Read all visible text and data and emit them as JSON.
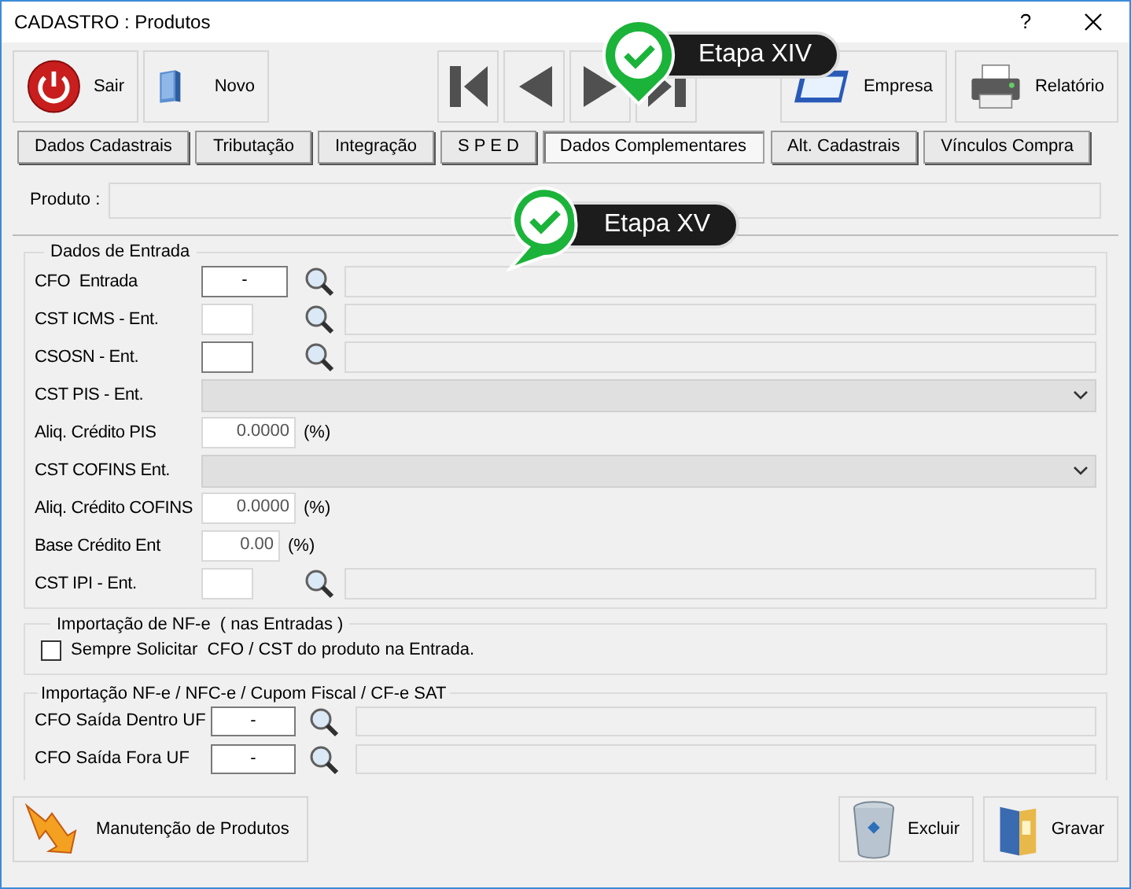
{
  "window": {
    "title": "CADASTRO : Produtos",
    "help": "?"
  },
  "toolbar": {
    "left": [
      {
        "label": "Sair"
      },
      {
        "label": "Novo"
      }
    ],
    "nav": [
      {
        "kind": "first"
      },
      {
        "kind": "prev"
      },
      {
        "kind": "next"
      },
      {
        "kind": "last"
      }
    ],
    "right": [
      {
        "label": "Empresa"
      },
      {
        "label": "Relatório"
      }
    ]
  },
  "tabs": [
    {
      "label": "Dados Cadastrais",
      "selected": false
    },
    {
      "label": "Tributação",
      "selected": false
    },
    {
      "label": "Integração",
      "selected": false
    },
    {
      "label": "S P E D",
      "selected": false
    },
    {
      "label": "Dados Complementares",
      "selected": true
    },
    {
      "label": "Alt. Cadastrais",
      "selected": false
    },
    {
      "label": "Vínculos Compra",
      "selected": false
    }
  ],
  "produto": {
    "label": "Produto :"
  },
  "dados_entrada": {
    "title": "Dados de Entrada",
    "rows": [
      {
        "kind": "lookup",
        "label": "CFO  Entrada",
        "value": "-",
        "disabled": false
      },
      {
        "kind": "lookup",
        "label": "CST ICMS - Ent.",
        "disabled": true
      },
      {
        "kind": "lookup",
        "label": "CSOSN - Ent.",
        "disabled": false
      },
      {
        "kind": "select",
        "label": "CST PIS - Ent."
      },
      {
        "kind": "percent",
        "label": "Aliq. Crédito PIS",
        "value": "0.0000",
        "unit": "(%)"
      },
      {
        "kind": "select",
        "label": "CST COFINS Ent."
      },
      {
        "kind": "percent",
        "label": "Aliq. Crédito COFINS",
        "value": "0.0000",
        "unit": "(%)"
      },
      {
        "kind": "percent",
        "label": "Base Crédito Ent",
        "value": "0.00",
        "unit": "(%)"
      },
      {
        "kind": "lookup",
        "label": "CST IPI - Ent.",
        "disabled": true
      }
    ]
  },
  "importacao_nfe": {
    "title": "Importação de NF-e  ( nas Entradas )",
    "checkbox": {
      "label": "Sempre Solicitar  CFO / CST do produto na Entrada.",
      "checked": false
    }
  },
  "importacao_saida": {
    "title": "Importação NF-e / NFC-e / Cupom Fiscal / CF-e SAT",
    "rows": [
      {
        "label": "CFO Saída Dentro UF",
        "value": "-"
      },
      {
        "label": "CFO Saída Fora UF",
        "value": "-"
      }
    ]
  },
  "bottom": {
    "left": {
      "label": "Manutenção de Produtos"
    },
    "right": [
      {
        "label": "Excluir"
      },
      {
        "label": "Gravar"
      }
    ]
  },
  "callouts": [
    {
      "label": "Etapa XIV"
    },
    {
      "label": "Etapa XV"
    }
  ]
}
